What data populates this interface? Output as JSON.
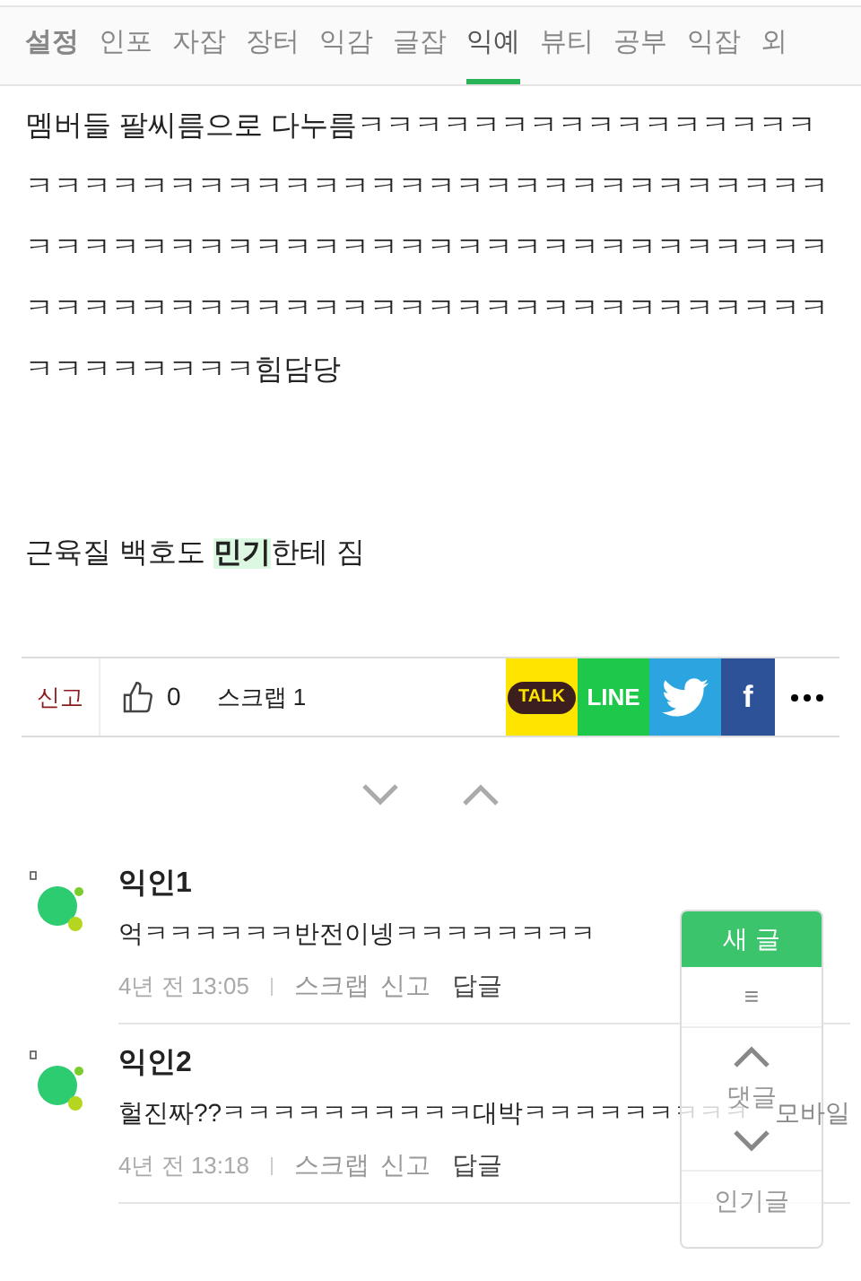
{
  "tabs": [
    {
      "label": "설정",
      "kind": "settings",
      "selected": false
    },
    {
      "label": "인포",
      "kind": "tab",
      "selected": false
    },
    {
      "label": "자잡",
      "kind": "tab",
      "selected": false
    },
    {
      "label": "장터",
      "kind": "tab",
      "selected": false
    },
    {
      "label": "익감",
      "kind": "tab",
      "selected": false
    },
    {
      "label": "글잡",
      "kind": "tab",
      "selected": false
    },
    {
      "label": "익예",
      "kind": "tab",
      "selected": true
    },
    {
      "label": "뷰티",
      "kind": "tab",
      "selected": false
    },
    {
      "label": "공부",
      "kind": "tab",
      "selected": false
    },
    {
      "label": "익잡",
      "kind": "tab",
      "selected": false
    },
    {
      "label": "외",
      "kind": "tab",
      "selected": false
    }
  ],
  "post": {
    "paragraphs": [
      [
        {
          "text": "멤버들 팔씨름으로 다누름ㅋㅋㅋㅋㅋㅋㅋㅋㅋㅋㅋㅋㅋㅋㅋㅋㅋㅋㅋㅋㅋㅋㅋㅋㅋㅋㅋㅋㅋㅋㅋㅋㅋㅋㅋㅋㅋㅋㅋㅋㅋㅋㅋㅋㅋㅋㅋㅋㅋㅋㅋㅋㅋㅋㅋㅋㅋㅋㅋㅋㅋㅋㅋㅋㅋㅋㅋㅋㅋㅋㅋㅋㅋㅋㅋㅋㅋㅋㅋㅋㅋㅋㅋㅋㅋㅋㅋㅋㅋㅋㅋㅋㅋㅋㅋㅋㅋㅋㅋㅋㅋㅋㅋㅋㅋㅋㅋㅋ힘담당",
          "highlight": false
        }
      ],
      [
        {
          "text": "근육질 백호도 ",
          "highlight": false
        },
        {
          "text": "민기",
          "highlight": true
        },
        {
          "text": "한테 짐",
          "highlight": false
        }
      ]
    ]
  },
  "actions": {
    "report": "신고",
    "likes": "0",
    "scrap": "스크랩 1",
    "share": [
      {
        "kind": "kakao",
        "label": "TALK"
      },
      {
        "kind": "line",
        "label": "LINE"
      },
      {
        "kind": "twitter"
      },
      {
        "kind": "facebook",
        "label": "f"
      },
      {
        "kind": "more"
      }
    ]
  },
  "comments": [
    {
      "author": "익인1",
      "text": "억ㅋㅋㅋㅋㅋㅋ반전이넹ㅋㅋㅋㅋㅋㅋㅋㅋ",
      "time": "4년 전  13:05",
      "scrap": "스크랩",
      "report": "신고",
      "reply": "답글"
    },
    {
      "author": "익인2",
      "text": "헐진짜??ㅋㅋㅋㅋㅋㅋㅋㅋㅋㅋ대박ㅋㅋㅋㅋㅋㅋㅋㅋㅋ",
      "badge": "모바일",
      "time": "4년 전  13:18",
      "scrap": "스크랩",
      "report": "신고",
      "reply": "답글"
    }
  ],
  "floating_panel": {
    "new_post": "새 글",
    "menu": "≡",
    "comments": "댓글",
    "popular": "인기글"
  }
}
